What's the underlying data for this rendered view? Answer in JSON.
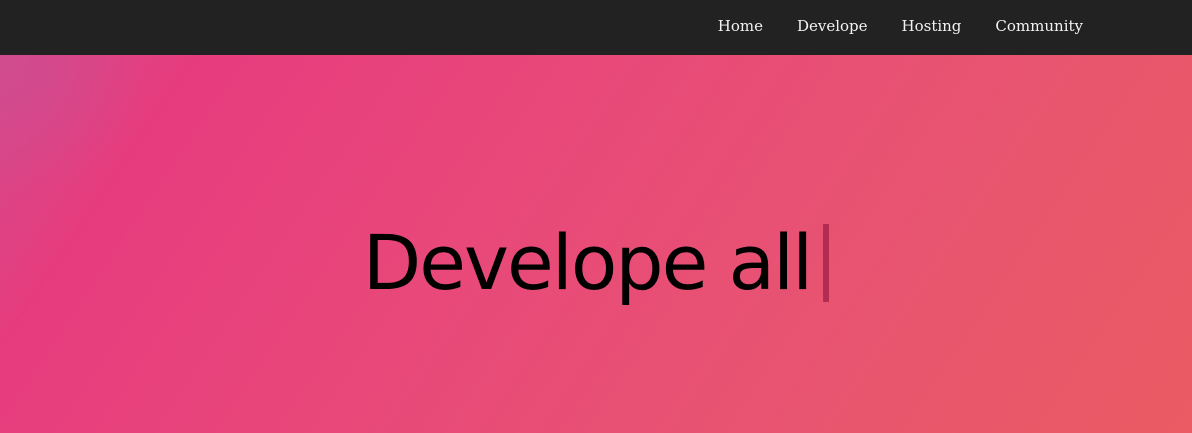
{
  "navbar": {
    "links": [
      {
        "label": "Home"
      },
      {
        "label": "Develope"
      },
      {
        "label": "Hosting"
      },
      {
        "label": "Community"
      }
    ]
  },
  "hero": {
    "headline": "Develope all"
  },
  "colors": {
    "navbar_bg": "#222222",
    "nav_text": "#f2f2f2",
    "hero_gradient_start": "#e73c7e",
    "hero_gradient_end": "#ea5b63",
    "caret": "#b22c52"
  }
}
